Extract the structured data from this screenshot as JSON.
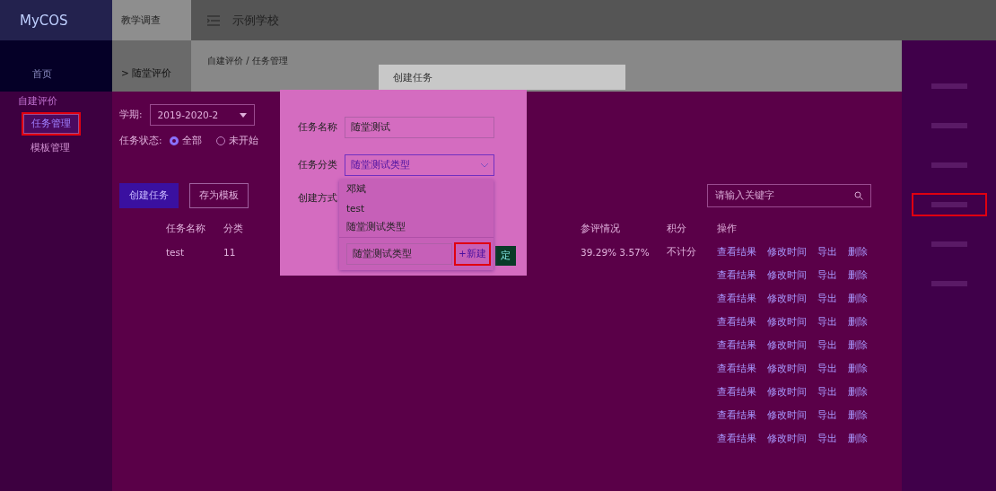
{
  "header": {
    "logo": "MyCOS",
    "module": "教学调查",
    "school": "示例学校"
  },
  "sidebar": {
    "items": [
      {
        "label": "首页"
      },
      {
        "label": "自建评价",
        "children": [
          {
            "label": "任务管理",
            "selected": true,
            "highlighted": true
          },
          {
            "label": "模板管理",
            "selected": false,
            "highlighted": false
          }
        ]
      }
    ]
  },
  "subnav": {
    "label": "> 随堂评价"
  },
  "breadcrumb": "自建评价 / 任务管理",
  "filters": {
    "term_label": "学期:",
    "term_value": "2019-2020-2",
    "status_label": "任务状态:",
    "status_options": [
      {
        "label": "全部",
        "selected": true
      },
      {
        "label": "未开始",
        "selected": false
      }
    ]
  },
  "toolbar": {
    "buttons": [
      "创建任务",
      "存为模板"
    ],
    "search": {
      "placeholder": "请输入关键字"
    }
  },
  "table": {
    "columns": [
      "任务名称",
      "分类",
      "参评情况",
      "积分",
      "操作"
    ],
    "rows": [
      {
        "cells": [
          "test",
          "11",
          "39.29% 3.57%",
          "不计分"
        ],
        "actions": [
          "查看结果",
          "修改时间",
          "导出",
          "删除"
        ]
      },
      {
        "cells": [],
        "actions": [
          "查看结果",
          "修改时间",
          "导出",
          "删除"
        ]
      },
      {
        "cells": [],
        "actions": [
          "查看结果",
          "修改时间",
          "导出",
          "删除"
        ]
      },
      {
        "cells": [],
        "actions": [
          "查看结果",
          "修改时间",
          "导出",
          "删除"
        ]
      },
      {
        "cells": [],
        "actions": [
          "查看结果",
          "修改时间",
          "导出",
          "删除"
        ]
      },
      {
        "cells": [],
        "actions": [
          "查看结果",
          "修改时间",
          "导出",
          "删除"
        ]
      },
      {
        "cells": [],
        "actions": [
          "查看结果",
          "修改时间",
          "导出",
          "删除"
        ]
      },
      {
        "cells": [],
        "actions": [
          "查看结果",
          "修改时间",
          "导出",
          "删除"
        ]
      },
      {
        "cells": [],
        "actions": [
          "查看结果",
          "修改时间",
          "导出",
          "删除"
        ]
      }
    ]
  },
  "right_panel": {
    "items": [
      {
        "highlighted": false
      },
      {
        "highlighted": false
      },
      {
        "highlighted": false
      },
      {
        "highlighted": true
      },
      {
        "highlighted": false
      },
      {
        "highlighted": false
      }
    ]
  },
  "dialog": {
    "title": "创建任务",
    "fields": [
      {
        "kind": "text",
        "label": "任务名称",
        "value": "随堂测试"
      },
      {
        "kind": "select",
        "label": "任务分类",
        "value": "随堂测试类型",
        "expanded": true
      },
      {
        "kind": "label",
        "label": "创建方式"
      }
    ],
    "dropdown": {
      "options": [
        {
          "label": "邓斌",
          "selected": false
        },
        {
          "label": "test",
          "selected": false
        },
        {
          "label": "随堂测试类型",
          "selected": false
        }
      ],
      "new_value": "随堂测试类型",
      "new_button": "+新建",
      "new_highlighted": true
    },
    "confirm": "定"
  }
}
